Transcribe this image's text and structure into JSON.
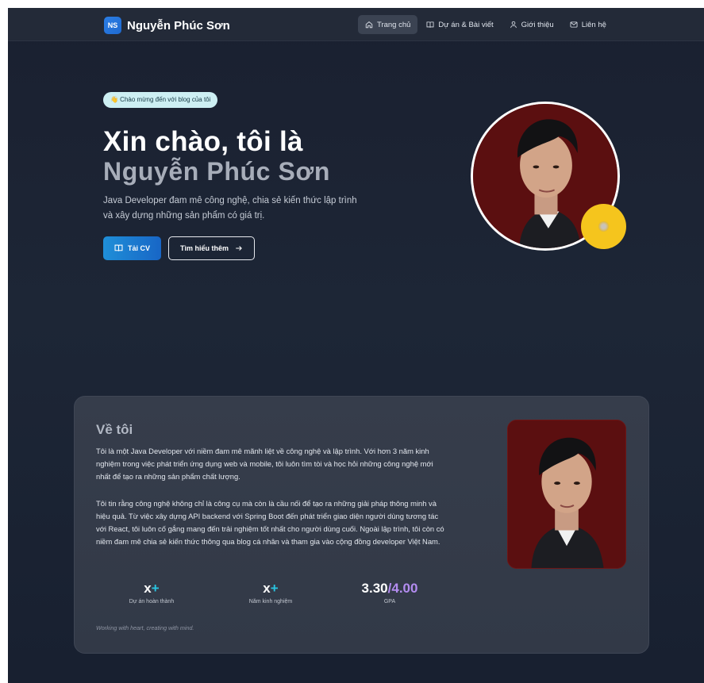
{
  "brand": {
    "badge": "NS",
    "name": "Nguyễn Phúc Sơn"
  },
  "nav": [
    {
      "label": "Trang chủ",
      "icon": "home-icon",
      "active": true
    },
    {
      "label": "Dự án & Bài viết",
      "icon": "book-icon",
      "active": false
    },
    {
      "label": "Giới thiệu",
      "icon": "user-icon",
      "active": false
    },
    {
      "label": "Liên hệ",
      "icon": "mail-icon",
      "active": false
    }
  ],
  "hero": {
    "badge": "👋 Chào mừng đến với blog của tôi",
    "greeting": "Xin chào, tôi là",
    "name": "Nguyễn Phúc Sơn",
    "description": "Java Developer đam mê công nghệ, chia sẻ kiến thức lập trình và xây dựng những sản phẩm có giá trị.",
    "cv_button": "Tải CV",
    "more_button": "Tìm hiểu thêm"
  },
  "about": {
    "title": "Về tôi",
    "p1": "Tôi là một Java Developer với niềm đam mê mãnh liệt về công nghệ và lập trình. Với hơn 3 năm kinh nghiệm trong việc phát triển ứng dụng web và mobile, tôi luôn tìm tòi và học hỏi những công nghệ mới nhất để tạo ra những sản phẩm chất lượng.",
    "p2": "Tôi tin rằng công nghệ không chỉ là công cụ mà còn là cầu nối để tạo ra những giải pháp thông minh và hiệu quả. Từ việc xây dựng API backend với Spring Boot đến phát triển giao diện người dùng tương tác với React, tôi luôn cố gắng mang đến trải nghiệm tốt nhất cho người dùng cuối. Ngoài lập trình, tôi còn có niềm đam mê chia sẻ kiến thức thông qua blog cá nhân và tham gia vào cộng đồng developer Việt Nam.",
    "stats": [
      {
        "value": "x",
        "suffix": "+",
        "label": "Dự án hoàn thành"
      },
      {
        "value": "x",
        "suffix": "+",
        "label": "Năm kinh nghiệm"
      },
      {
        "value": "3.30",
        "suffix": "/4.00",
        "label": "GPA"
      }
    ],
    "quote": "Working with heart, creating with mind."
  },
  "colors": {
    "accent": "#1f7fd8",
    "badge_bg": "#cdeff3",
    "dot": "#f5c51d",
    "gpa_total": "#b38cf0",
    "plus": "#29c3e0"
  }
}
